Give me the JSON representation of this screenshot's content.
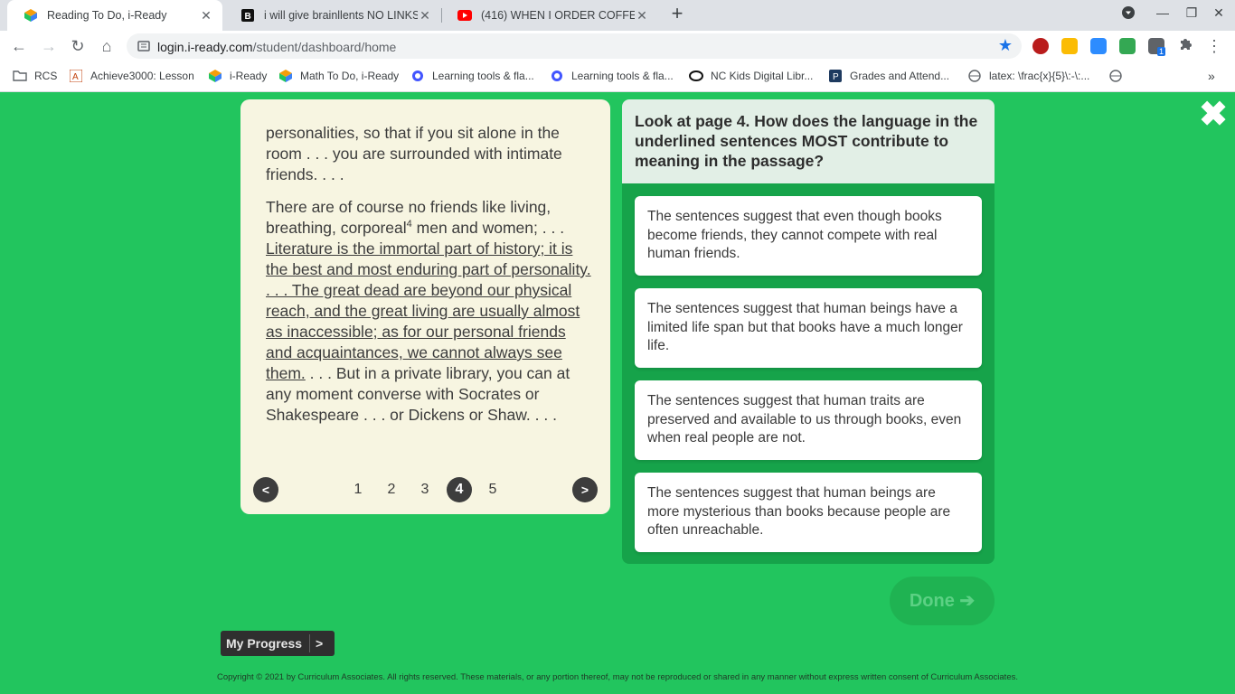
{
  "browser": {
    "tabs": [
      {
        "title": "Reading To Do, i-Ready",
        "icon": "iready-icon",
        "active": true
      },
      {
        "title": "i will give brainllents NO LINKS -",
        "icon": "brainly-icon",
        "active": false
      },
      {
        "title": "(416) WHEN I ORDER COFFEE - S",
        "icon": "youtube-icon",
        "active": false
      }
    ],
    "url_domain": "login.i-ready.com",
    "url_path": "/student/dashboard/home",
    "bookmarks": [
      {
        "label": "RCS",
        "icon": "folder-icon"
      },
      {
        "label": "Achieve3000: Lesson",
        "icon": "achieve-icon"
      },
      {
        "label": "i-Ready",
        "icon": "iready-icon"
      },
      {
        "label": "Math To Do, i-Ready",
        "icon": "iready-icon"
      },
      {
        "label": "Learning tools & fla...",
        "icon": "quizlet-icon"
      },
      {
        "label": "Learning tools & fla...",
        "icon": "quizlet-icon"
      },
      {
        "label": "NC Kids Digital Libr...",
        "icon": "overdrive-icon"
      },
      {
        "label": "Grades and Attend...",
        "icon": "powerschool-icon"
      },
      {
        "label": "latex: \\frac{x}{5}\\:-\\:...",
        "icon": "globe-icon"
      }
    ],
    "extension_badge": "1"
  },
  "passage": {
    "p1": "personalities, so that if you sit alone in the room . . . you are surrounded with intimate friends. . . .",
    "p2_start": "There are of course no friends like living, breathing, corporeal",
    "p2_sup": "4",
    "p2_mid": " men and women; . . . ",
    "p2_underlined": "Literature is the immortal part of history; it is the best and most enduring part of personality. . . . The great dead are beyond our physical reach, and the great living are usually almost as inaccessible; as for our personal friends and acquaintances, we cannot always see them.",
    "p2_end": " . . . But in a private library, you can at any moment converse with Socrates or Shakespeare . . . or Dickens or Shaw. . . ."
  },
  "pager": {
    "prev": "<",
    "next": ">",
    "pages": [
      "1",
      "2",
      "3",
      "4",
      "5"
    ],
    "current": "4"
  },
  "question": {
    "text": "Look at page 4. How does the language in the underlined sentences MOST contribute to meaning in the passage?",
    "answers": [
      "The sentences suggest that even though books become friends, they cannot compete with real human friends.",
      "The sentences suggest that human beings have a limited life span but that books have a much longer life.",
      "The sentences suggest that human traits are preserved and available to us through books, even when real people are not.",
      "The sentences suggest that human beings are more mysterious than books because people are often unreachable."
    ]
  },
  "done_label": "Done",
  "progress_label": "My Progress",
  "progress_arrow": ">",
  "copyright": "Copyright © 2021 by Curriculum Associates. All rights reserved. These materials, or any portion thereof, may not be reproduced or shared in any manner without express written consent of Curriculum Associates.",
  "colors": {
    "background": "#22c55e",
    "passage_bg": "#f7f5e1",
    "question_bg": "#e2efe6",
    "dark": "#3d3d3d"
  }
}
